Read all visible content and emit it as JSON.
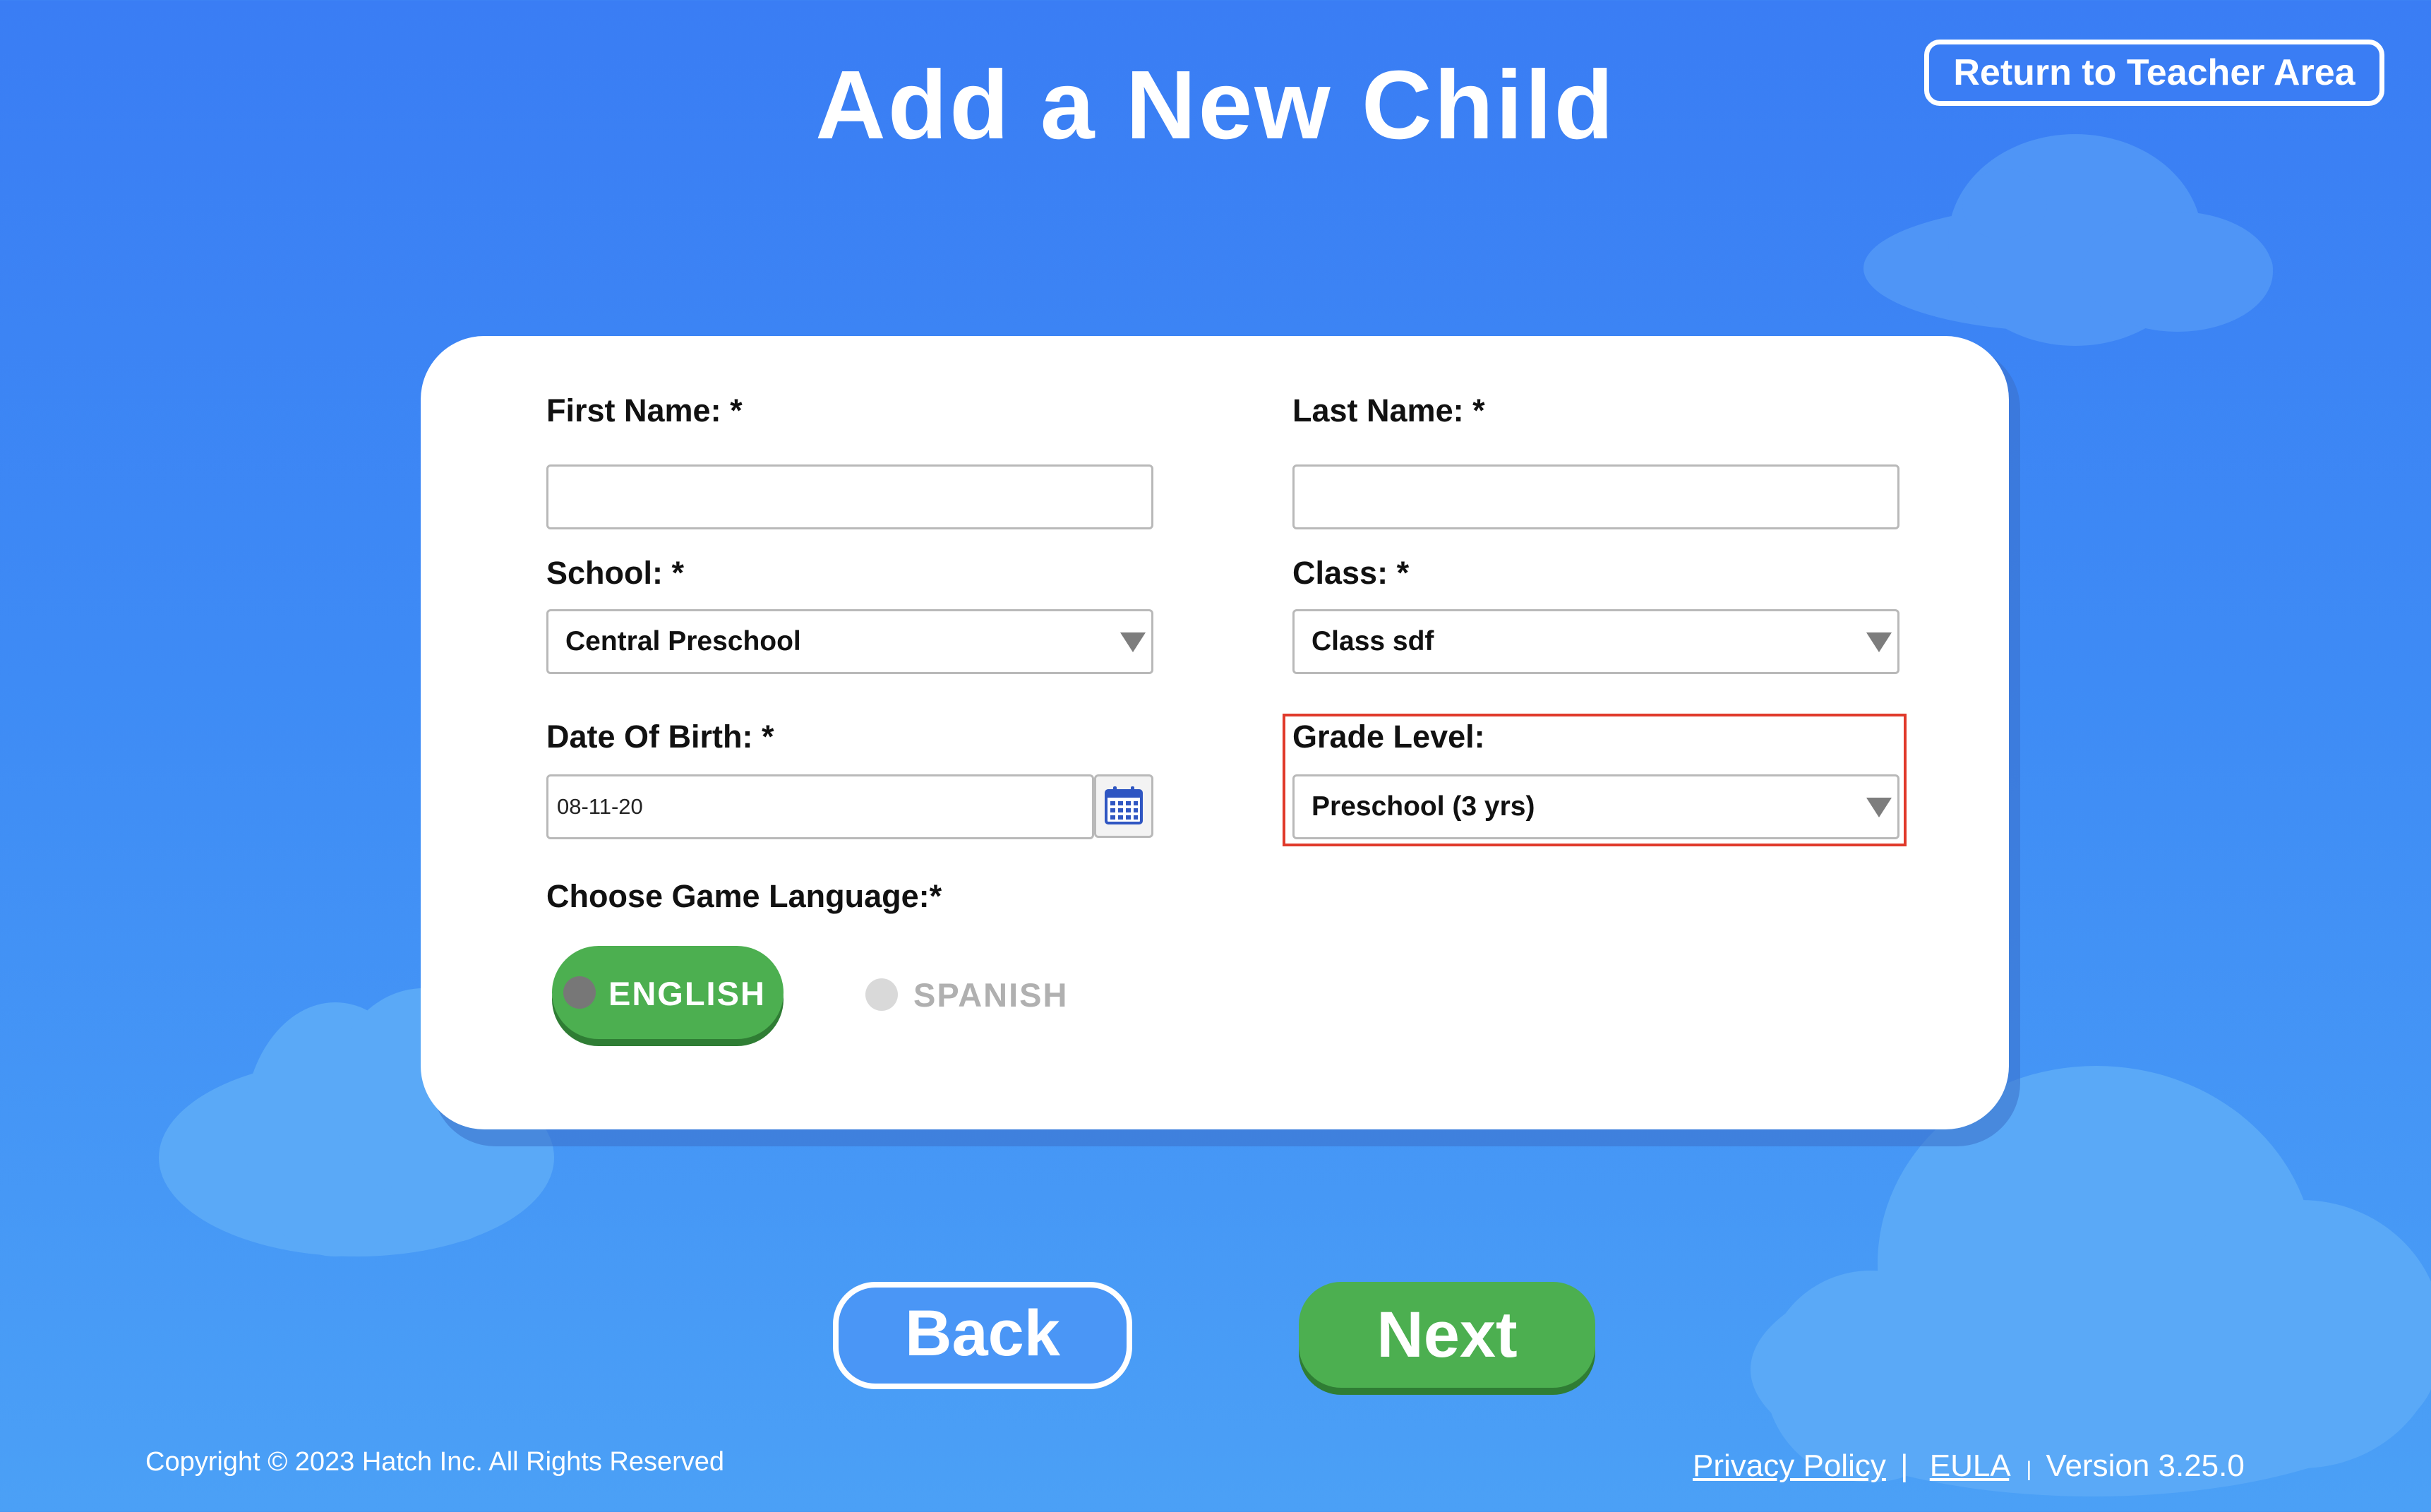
{
  "header": {
    "title": "Add a New Child",
    "return_button": "Return to Teacher Area"
  },
  "form": {
    "first_name": {
      "label": "First Name: *",
      "value": ""
    },
    "last_name": {
      "label": "Last Name: *",
      "value": ""
    },
    "school": {
      "label": "School: *",
      "value": "Central Preschool"
    },
    "class": {
      "label": "Class: *",
      "value": "Class sdf"
    },
    "dob": {
      "label": "Date Of Birth: *",
      "value": "08-11-20"
    },
    "grade": {
      "label": "Grade Level:",
      "value": "Preschool (3 yrs)"
    },
    "language": {
      "label": "Choose Game Language:*",
      "options": [
        "ENGLISH",
        "SPANISH"
      ],
      "selected": "ENGLISH"
    }
  },
  "actions": {
    "back": "Back",
    "next": "Next"
  },
  "footer": {
    "copyright": "Copyright © 2023 Hatch Inc. All Rights Reserved",
    "privacy": "Privacy Policy",
    "separator": "|",
    "eula": "EULA",
    "version": "Version 3.25.0"
  },
  "colors": {
    "background": "#3a7df4",
    "accent_green": "#4caf50",
    "highlight_red": "#e0392a",
    "card": "#ffffff"
  }
}
